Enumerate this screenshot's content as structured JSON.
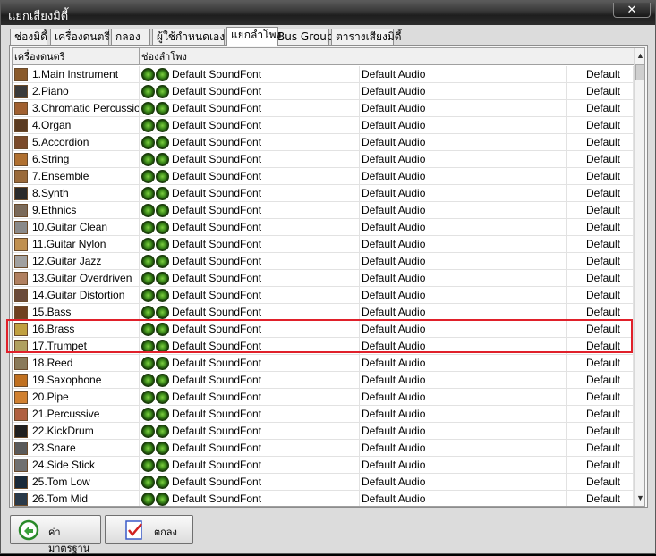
{
  "window": {
    "title": "แยกเสียงมิดี้",
    "close_label": "✕"
  },
  "tabs": [
    {
      "label": "ช่องมิดี้",
      "active": false
    },
    {
      "label": "เครื่องดนตรี",
      "active": false
    },
    {
      "label": "กลอง",
      "active": false
    },
    {
      "label": "ผู้ใช้กำหนดเอง",
      "active": false
    },
    {
      "label": "แยกลำโพง",
      "active": true
    },
    {
      "label": "Bus Group",
      "active": false
    },
    {
      "label": "ตารางเสียงมิดี้",
      "active": false
    }
  ],
  "grid": {
    "columns": [
      "เครื่องดนตรี",
      "ช่องลำโพง",
      "",
      ""
    ],
    "rows": [
      {
        "name": "1.Main Instrument",
        "soundfont": "Default SoundFont",
        "audio": "Default Audio",
        "default": "Default",
        "icon": "main-instrument-icon"
      },
      {
        "name": "2.Piano",
        "soundfont": "Default SoundFont",
        "audio": "Default Audio",
        "default": "Default",
        "icon": "piano-icon"
      },
      {
        "name": "3.Chromatic Percussion",
        "soundfont": "Default SoundFont",
        "audio": "Default Audio",
        "default": "Default",
        "icon": "chromatic-percussion-icon"
      },
      {
        "name": "4.Organ",
        "soundfont": "Default SoundFont",
        "audio": "Default Audio",
        "default": "Default",
        "icon": "organ-icon"
      },
      {
        "name": "5.Accordion",
        "soundfont": "Default SoundFont",
        "audio": "Default Audio",
        "default": "Default",
        "icon": "accordion-icon"
      },
      {
        "name": "6.String",
        "soundfont": "Default SoundFont",
        "audio": "Default Audio",
        "default": "Default",
        "icon": "string-icon"
      },
      {
        "name": "7.Ensemble",
        "soundfont": "Default SoundFont",
        "audio": "Default Audio",
        "default": "Default",
        "icon": "ensemble-icon"
      },
      {
        "name": "8.Synth",
        "soundfont": "Default SoundFont",
        "audio": "Default Audio",
        "default": "Default",
        "icon": "synth-icon"
      },
      {
        "name": "9.Ethnics",
        "soundfont": "Default SoundFont",
        "audio": "Default Audio",
        "default": "Default",
        "icon": "ethnics-icon"
      },
      {
        "name": "10.Guitar Clean",
        "soundfont": "Default SoundFont",
        "audio": "Default Audio",
        "default": "Default",
        "icon": "guitar-clean-icon"
      },
      {
        "name": "11.Guitar Nylon",
        "soundfont": "Default SoundFont",
        "audio": "Default Audio",
        "default": "Default",
        "icon": "guitar-nylon-icon"
      },
      {
        "name": "12.Guitar Jazz",
        "soundfont": "Default SoundFont",
        "audio": "Default Audio",
        "default": "Default",
        "icon": "guitar-jazz-icon"
      },
      {
        "name": "13.Guitar Overdriven",
        "soundfont": "Default SoundFont",
        "audio": "Default Audio",
        "default": "Default",
        "icon": "guitar-overdriven-icon"
      },
      {
        "name": "14.Guitar Distortion",
        "soundfont": "Default SoundFont",
        "audio": "Default Audio",
        "default": "Default",
        "icon": "guitar-distortion-icon"
      },
      {
        "name": "15.Bass",
        "soundfont": "Default SoundFont",
        "audio": "Default Audio",
        "default": "Default",
        "icon": "bass-icon"
      },
      {
        "name": "16.Brass",
        "soundfont": "Default SoundFont",
        "audio": "Default Audio",
        "default": "Default",
        "icon": "brass-icon"
      },
      {
        "name": "17.Trumpet",
        "soundfont": "Default SoundFont",
        "audio": "Default Audio",
        "default": "Default",
        "icon": "trumpet-icon"
      },
      {
        "name": "18.Reed",
        "soundfont": "Default SoundFont",
        "audio": "Default Audio",
        "default": "Default",
        "icon": "reed-icon"
      },
      {
        "name": "19.Saxophone",
        "soundfont": "Default SoundFont",
        "audio": "Default Audio",
        "default": "Default",
        "icon": "saxophone-icon"
      },
      {
        "name": "20.Pipe",
        "soundfont": "Default SoundFont",
        "audio": "Default Audio",
        "default": "Default",
        "icon": "pipe-icon"
      },
      {
        "name": "21.Percussive",
        "soundfont": "Default SoundFont",
        "audio": "Default Audio",
        "default": "Default",
        "icon": "percussive-icon"
      },
      {
        "name": "22.KickDrum",
        "soundfont": "Default SoundFont",
        "audio": "Default Audio",
        "default": "Default",
        "icon": "kickdrum-icon"
      },
      {
        "name": "23.Snare",
        "soundfont": "Default SoundFont",
        "audio": "Default Audio",
        "default": "Default",
        "icon": "snare-icon"
      },
      {
        "name": "24.Side Stick",
        "soundfont": "Default SoundFont",
        "audio": "Default Audio",
        "default": "Default",
        "icon": "side-stick-icon"
      },
      {
        "name": "25.Tom Low",
        "soundfont": "Default SoundFont",
        "audio": "Default Audio",
        "default": "Default",
        "icon": "tom-low-icon"
      },
      {
        "name": "26.Tom Mid",
        "soundfont": "Default SoundFont",
        "audio": "Default Audio",
        "default": "Default",
        "icon": "tom-mid-icon"
      }
    ]
  },
  "buttons": {
    "default_label": "ค่ามาตรฐาน",
    "ok_label": "ตกลง"
  },
  "colors": {
    "highlight": "#e0202a",
    "led": "#3b8a1a"
  }
}
